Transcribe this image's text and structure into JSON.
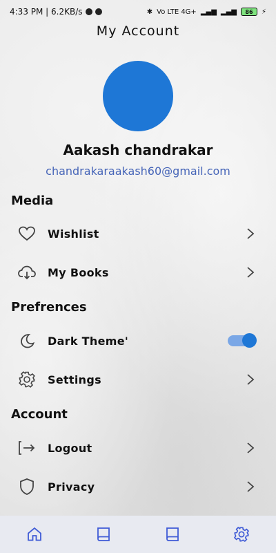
{
  "status_bar": {
    "time_speed": "4:33 PM | 6.2KB/s",
    "network_labels": "Vo LTE 4G+",
    "battery": "86"
  },
  "header": {
    "title": "My Account"
  },
  "profile": {
    "name": "Aakash chandrakar",
    "email": "chandrakaraakash60@gmail.com",
    "avatar_color": "#1E77D6"
  },
  "sections": {
    "media": {
      "title": "Media",
      "items": [
        {
          "label": "Wishlist",
          "icon": "heart-icon"
        },
        {
          "label": "My Books",
          "icon": "cloud-download-icon"
        }
      ]
    },
    "preferences": {
      "title": "Prefrences",
      "items": [
        {
          "label": "Dark Theme'",
          "icon": "moon-icon",
          "toggle_on": true
        },
        {
          "label": "Settings",
          "icon": "gear-icon"
        }
      ]
    },
    "account": {
      "title": "Account",
      "items": [
        {
          "label": "Logout",
          "icon": "logout-icon"
        },
        {
          "label": "Privacy",
          "icon": "shield-icon"
        }
      ]
    }
  },
  "bottom_nav": {
    "items": [
      {
        "icon": "home-icon"
      },
      {
        "icon": "book-icon"
      },
      {
        "icon": "book-icon"
      },
      {
        "icon": "gear-icon",
        "active": true
      }
    ],
    "active_color": "#3F5BD6"
  },
  "colors": {
    "accent": "#1E77D6",
    "email_text": "#4665B8",
    "toggle_track": "#7AA7E6"
  }
}
